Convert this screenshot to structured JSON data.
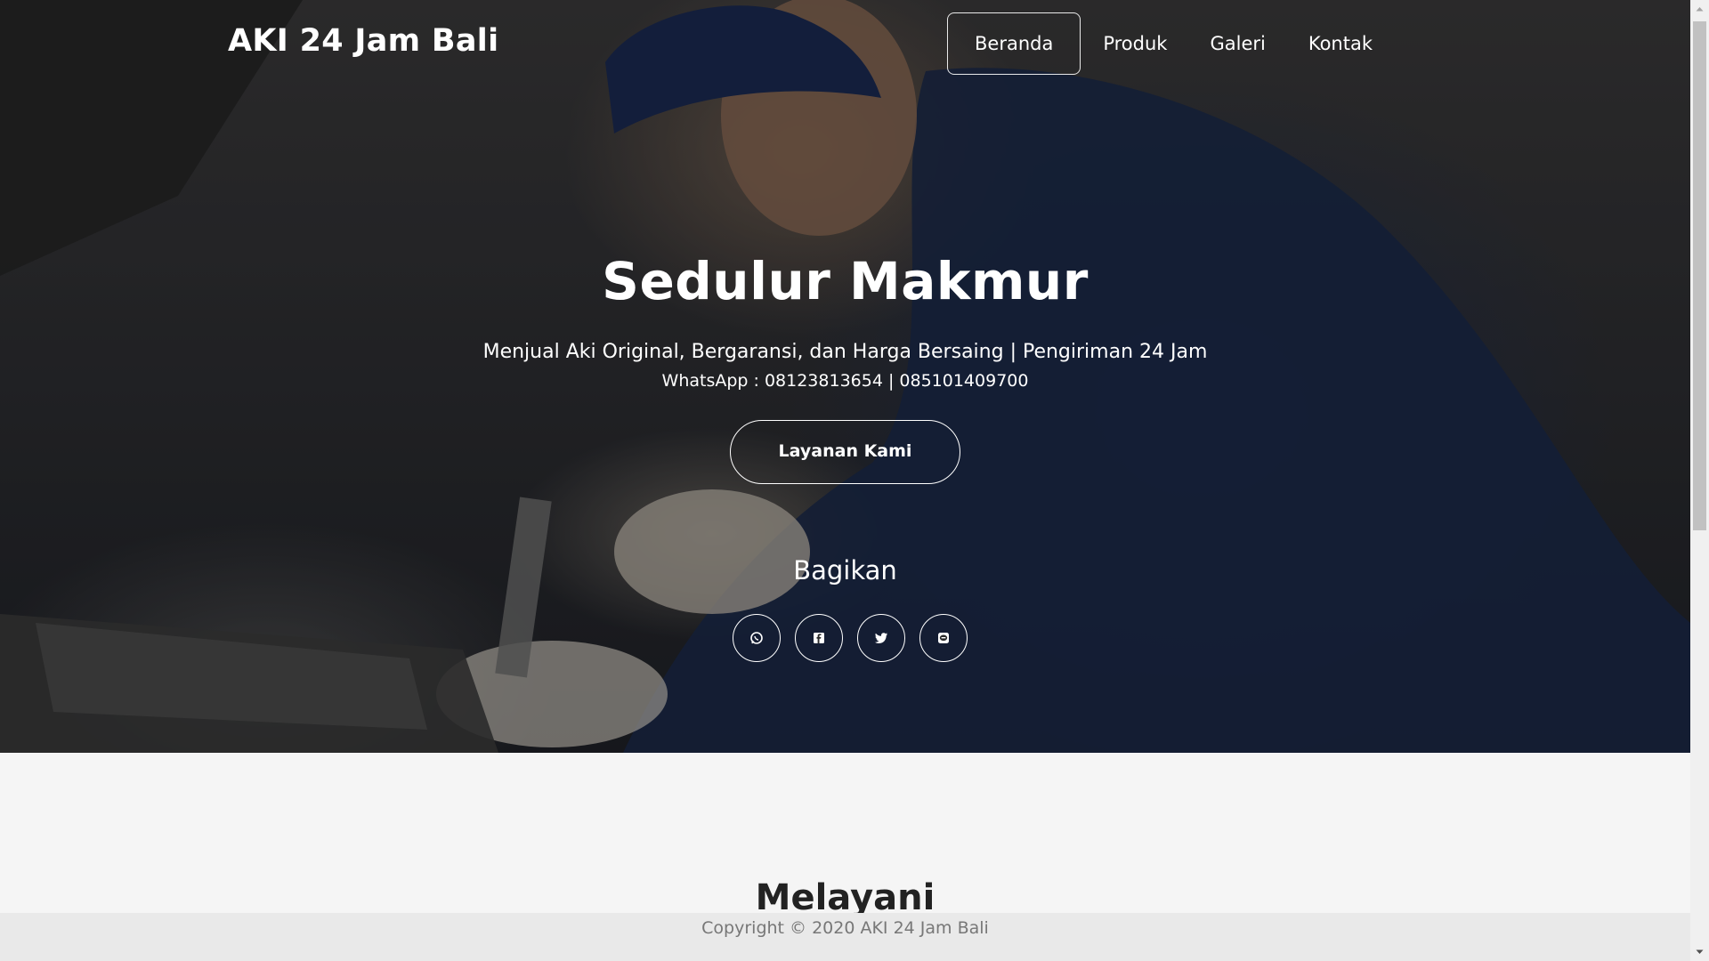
{
  "header": {
    "brand": "AKI 24 Jam Bali",
    "nav": [
      {
        "label": "Beranda",
        "active": true
      },
      {
        "label": "Produk",
        "active": false
      },
      {
        "label": "Galeri",
        "active": false
      },
      {
        "label": "Kontak",
        "active": false
      }
    ]
  },
  "hero": {
    "title": "Sedulur Makmur",
    "subtitle": "Menjual Aki Original, Bergaransi, dan Harga Bersaing | Pengiriman 24 Jam",
    "contact": "WhatsApp : 08123813654 | 085101409700",
    "cta_label": "Layanan Kami",
    "share_title": "Bagikan",
    "share_buttons": [
      {
        "icon": "whatsapp-icon"
      },
      {
        "icon": "facebook-icon"
      },
      {
        "icon": "twitter-icon"
      },
      {
        "icon": "line-icon"
      }
    ]
  },
  "section": {
    "title": "Melayani"
  },
  "footer": {
    "copyright": "Copyright © 2020 AKI 24 Jam Bali"
  },
  "colors": {
    "text_on_hero": "#ffffff",
    "section_bg": "#f5f5f5",
    "footer_bg": "#e9e9e9",
    "footer_text": "#777777"
  }
}
